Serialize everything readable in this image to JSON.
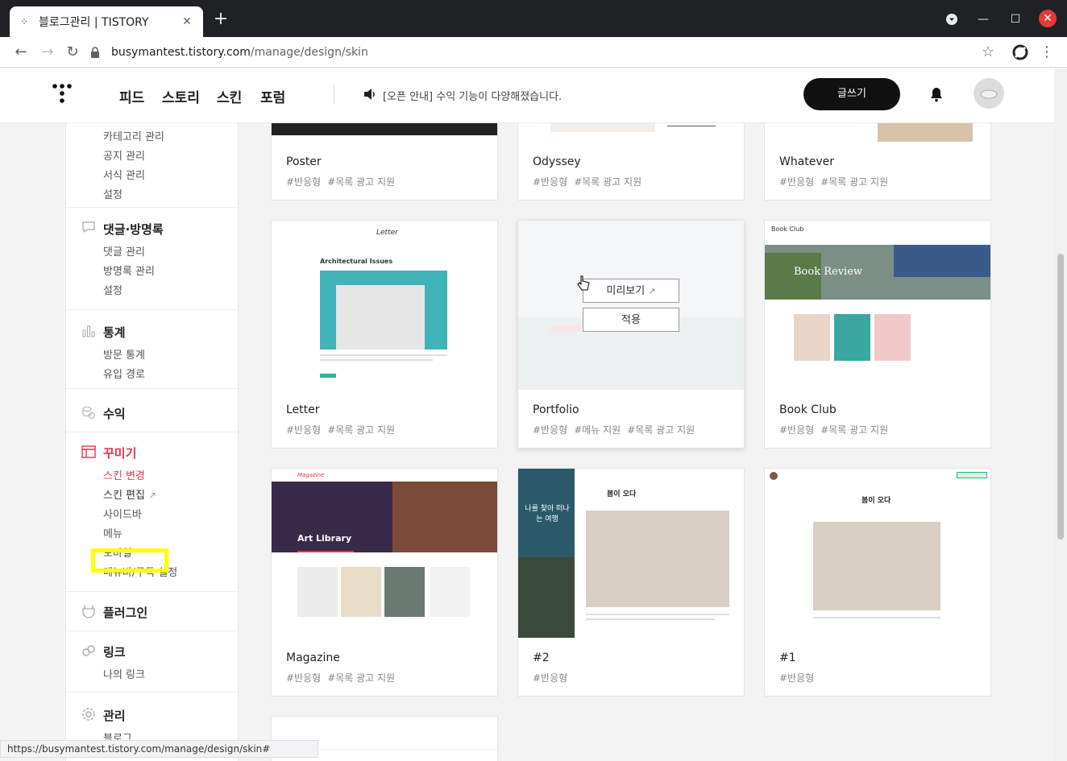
{
  "browser": {
    "tab_title": "블로그관리 | TISTORY",
    "url_host": "busymantest.tistory.com",
    "url_path": "/manage/design/skin",
    "status_url": "https://busymantest.tistory.com/manage/design/skin#"
  },
  "header": {
    "nav": [
      "피드",
      "스토리",
      "스킨",
      "포럼"
    ],
    "notice": "[오픈 안내] 수익 기능이 다양해졌습니다.",
    "write_label": "글쓰기"
  },
  "sidebar": {
    "content_items": [
      "카테고리 관리",
      "공지 관리",
      "서식 관리",
      "설정"
    ],
    "comments": {
      "title": "댓글·방명록",
      "items": [
        "댓글 관리",
        "방명록 관리",
        "설정"
      ]
    },
    "stats": {
      "title": "통계",
      "items": [
        "방문 통계",
        "유입 경로"
      ]
    },
    "revenue": {
      "title": "수익"
    },
    "design": {
      "title": "꾸미기",
      "items": [
        "스킨 변경",
        "스킨 편집",
        "사이드바",
        "메뉴",
        "모바일",
        "메뉴바/구독 설정"
      ]
    },
    "plugin": {
      "title": "플러그인"
    },
    "link": {
      "title": "링크",
      "items": [
        "나의 링크"
      ]
    },
    "manage": {
      "title": "관리",
      "items": [
        "블로그"
      ]
    }
  },
  "skins": [
    {
      "name": "Poster",
      "tags": [
        "#반응형",
        "#목록 광고 지원"
      ]
    },
    {
      "name": "Odyssey",
      "tags": [
        "#반응형",
        "#목록 광고 지원"
      ]
    },
    {
      "name": "Whatever",
      "tags": [
        "#반응형",
        "#목록 광고 지원"
      ]
    },
    {
      "name": "Letter",
      "tags": [
        "#반응형",
        "#목록 광고 지원"
      ]
    },
    {
      "name": "Portfolio",
      "tags": [
        "#반응형",
        "#메뉴 지원",
        "#목록 광고 지원"
      ]
    },
    {
      "name": "Book Club",
      "tags": [
        "#반응형",
        "#목록 광고 지원"
      ]
    },
    {
      "name": "Magazine",
      "tags": [
        "#반응형",
        "#목록 광고 지원"
      ]
    },
    {
      "name": "#2",
      "tags": [
        "#반응형"
      ]
    },
    {
      "name": "#1",
      "tags": [
        "#반응형"
      ]
    }
  ],
  "hover": {
    "preview_label": "미리보기",
    "apply_label": "적용"
  },
  "thumbs": {
    "letter_brand": "Letter",
    "letter_heading": "Architectural Issues",
    "bookclub_title": "Book Club",
    "bookclub_banner": "Book Review",
    "magazine_brand": "Magazine",
    "magazine_banner": "Art Library",
    "post_title": "봄이 오다",
    "theme2_side": "나를 찾아 떠나는 여행"
  }
}
